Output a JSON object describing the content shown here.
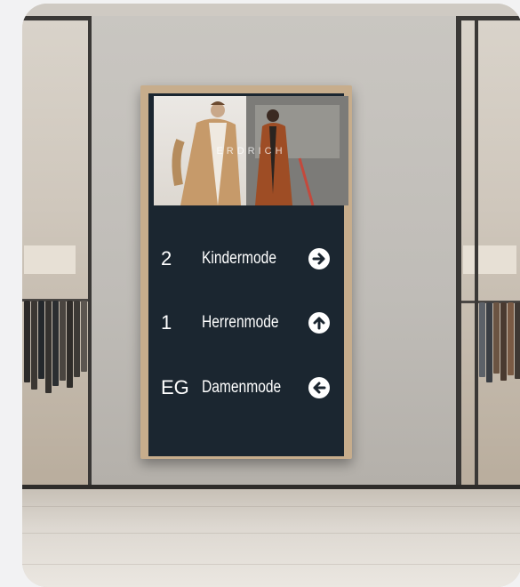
{
  "scene": {
    "description_note": "",
    "colors": {
      "screen": "#1b2630",
      "frame": "#c7ad8c",
      "text": "#ffffff"
    }
  },
  "sign": {
    "brand_text": "ERDRICH",
    "directory": [
      {
        "floor": "2",
        "department": "Kindermode",
        "arrow": "arrow-right-icon"
      },
      {
        "floor": "1",
        "department": "Herrenmode",
        "arrow": "arrow-up-icon"
      },
      {
        "floor": "EG",
        "department": "Damenmode",
        "arrow": "arrow-left-icon"
      }
    ]
  }
}
